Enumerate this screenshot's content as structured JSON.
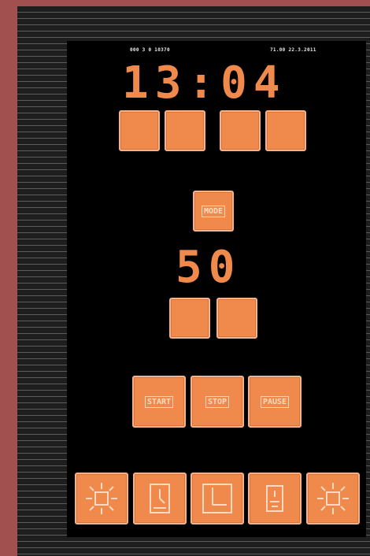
{
  "status": {
    "left": "000 3 0 10370",
    "right": "71.00 22.3.2011"
  },
  "clock": {
    "time": "13:04"
  },
  "counter": {
    "value": "50"
  },
  "mode_button": {
    "label": "MODE"
  },
  "controls": {
    "start_label": "START",
    "stop_label": "STOP",
    "pause_label": "PAUSE"
  },
  "icons": [
    "sun-icon",
    "timer-icon",
    "clock-icon",
    "timer-icon",
    "sun-icon"
  ],
  "colors": {
    "accent": "#f08a4c",
    "screen": "#000000",
    "frame": "#a14f4f"
  }
}
